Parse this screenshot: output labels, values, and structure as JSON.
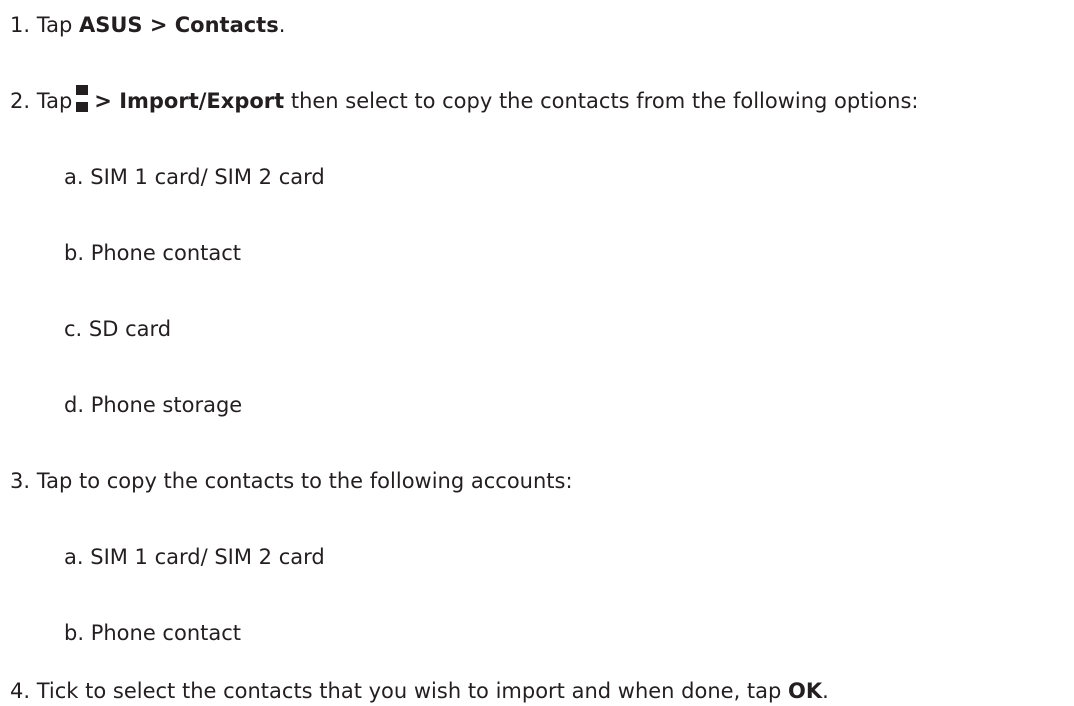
{
  "steps": {
    "s1": {
      "num": "1.",
      "pre": "Tap ",
      "bold1": "ASUS > Contacts",
      "post": "."
    },
    "s2": {
      "num": "2.",
      "pre": "Tap",
      "bold1": "> Import/Export",
      "post": " then select to copy the contacts from the following options:",
      "icon": "overflow-menu-icon",
      "options": [
        {
          "letter": "a.",
          "text": "SIM 1 card/ SIM 2 card"
        },
        {
          "letter": "b.",
          "text": "Phone contact"
        },
        {
          "letter": "c.",
          "text": "SD card"
        },
        {
          "letter": "d.",
          "text": "Phone storage"
        }
      ]
    },
    "s3": {
      "num": "3.",
      "text": "Tap to copy the contacts to the following accounts:",
      "options": [
        {
          "letter": "a.",
          "text": "SIM 1 card/ SIM 2 card"
        },
        {
          "letter": "b.",
          "text": "Phone contact"
        }
      ]
    },
    "s4": {
      "num": "4.",
      "pre": "Tick to select the contacts that you wish to import and when done, tap ",
      "bold1": "OK",
      "post": "."
    }
  },
  "colors": {
    "text": "#231f20"
  }
}
